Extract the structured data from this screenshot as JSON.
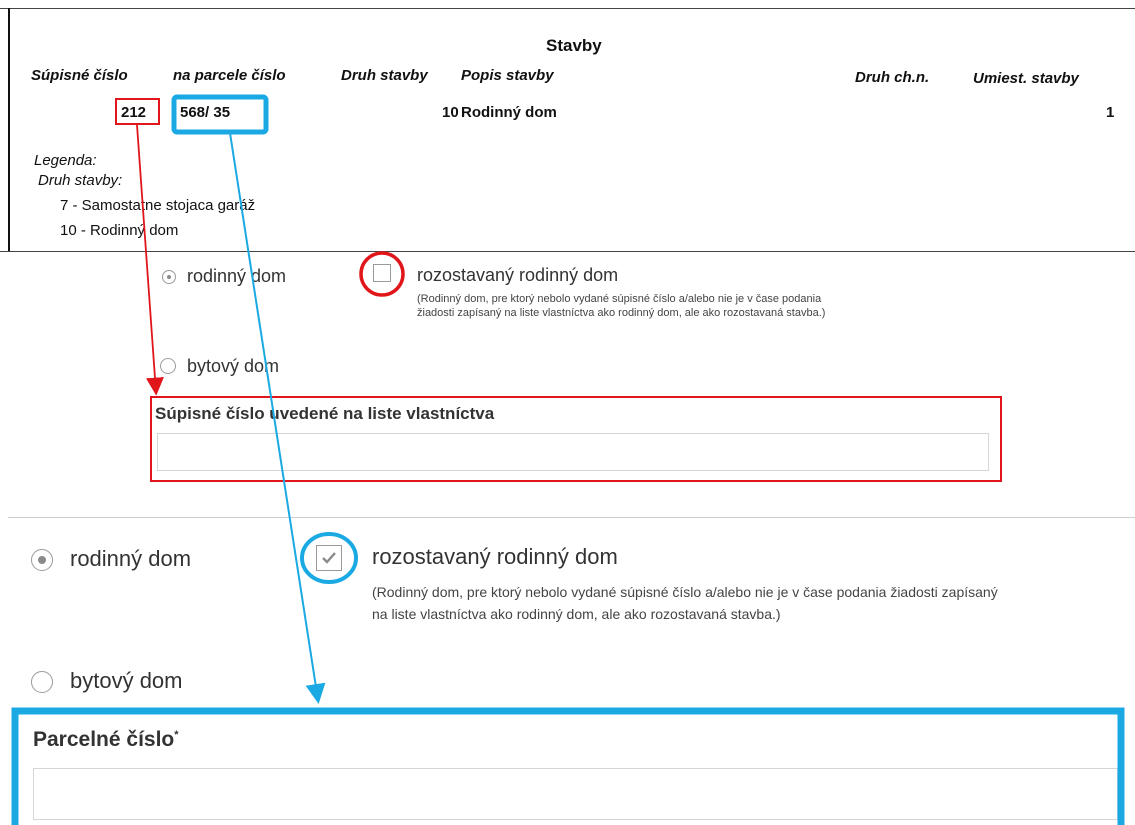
{
  "excerpt": {
    "section_title": "Stavby",
    "headers": {
      "supisne_cislo": "Súpisné číslo",
      "na_parcele_cislo": "na parcele číslo",
      "druh_stavby": "Druh stavby",
      "popis_stavby": "Popis stavby",
      "druh_chn": "Druh ch.n.",
      "umiest_stavby": "Umiest. stavby"
    },
    "row": {
      "supisne_cislo": "212",
      "parcela": "568/ 35",
      "druh_stavby": "10",
      "popis_stavby": "Rodinný dom",
      "umiest_stavby": "1"
    },
    "legend": {
      "title": "Legenda:",
      "subtitle": "Druh stavby:",
      "items": [
        "7 - Samostatne stojaca garáž",
        "10 - Rodinný dom"
      ]
    }
  },
  "form_small": {
    "radio_rodinny": "rodinný dom",
    "checkbox_label": "rozostavaný rodinný dom",
    "note_line1": "(Rodinný dom, pre ktorý nebolo vydané súpisné číslo a/alebo nie je v čase podania",
    "note_line2": "žiadosti zapísaný na liste vlastníctva ako rodinný dom, ale ako rozostavaná stavba.)",
    "radio_bytovy": "bytový dom",
    "field_label": "Súpisné číslo uvedené na liste vlastníctva",
    "field_value": "",
    "checkbox_checked": false
  },
  "form_large": {
    "radio_rodinny": "rodinný dom",
    "checkbox_label": "rozostavaný rodinný dom",
    "note_line1": "(Rodinný dom, pre ktorý nebolo vydané súpisné číslo a/alebo nie je v čase podania žiadosti zapísaný",
    "note_line2": "na liste vlastníctva ako rodinný dom, ale ako rozostavaná stavba.)",
    "radio_bytovy": "bytový dom",
    "field_label": "Parcelné číslo",
    "required_mark": "*",
    "field_value": "",
    "checkbox_checked": true
  },
  "colors": {
    "red_annotation": "#e0161b",
    "blue_annotation": "#1aa9e2"
  }
}
